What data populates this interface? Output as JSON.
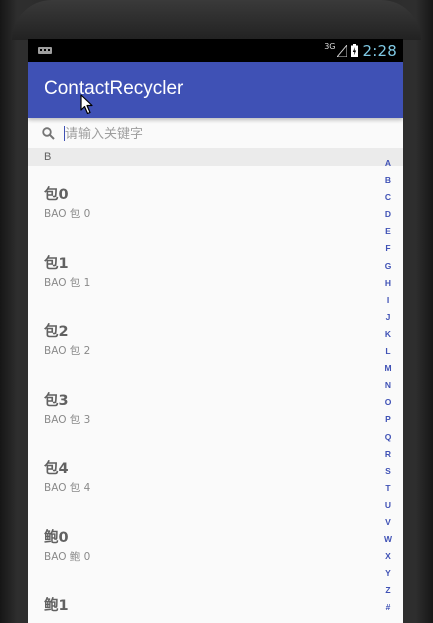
{
  "status_bar": {
    "network": "3G",
    "time": "2:28",
    "icons": [
      "notification-icon",
      "signal-icon",
      "battery-icon"
    ]
  },
  "app_bar": {
    "title": "ContactRecycler"
  },
  "search": {
    "placeholder": "请输入关键字",
    "value": "",
    "icon": "search-icon"
  },
  "section": {
    "letter": "B"
  },
  "contacts": [
    {
      "name": "包0",
      "pinyin": "BAO 包 0"
    },
    {
      "name": "包1",
      "pinyin": "BAO 包 1"
    },
    {
      "name": "包2",
      "pinyin": "BAO 包 2"
    },
    {
      "name": "包3",
      "pinyin": "BAO 包 3"
    },
    {
      "name": "包4",
      "pinyin": "BAO 包 4"
    },
    {
      "name": "鲍0",
      "pinyin": "BAO 鲍 0"
    },
    {
      "name": "鲍1",
      "pinyin": ""
    }
  ],
  "index_bar": [
    "A",
    "B",
    "C",
    "D",
    "E",
    "F",
    "G",
    "H",
    "I",
    "J",
    "K",
    "L",
    "M",
    "N",
    "O",
    "P",
    "Q",
    "R",
    "S",
    "T",
    "U",
    "V",
    "W",
    "X",
    "Y",
    "Z",
    "#"
  ],
  "colors": {
    "primary": "#3f51b5",
    "background": "#fafafa",
    "section_header": "#ebebeb",
    "status_time": "#7ec8e3"
  }
}
